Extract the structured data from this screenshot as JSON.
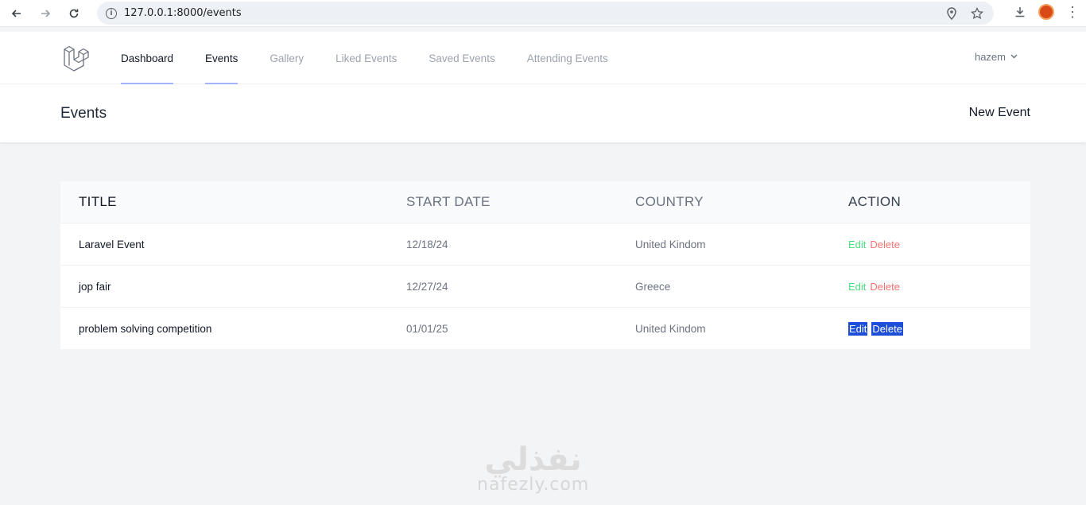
{
  "browser": {
    "url": "127.0.0.1:8000/events"
  },
  "nav": {
    "links": [
      "Dashboard",
      "Events",
      "Gallery",
      "Liked Events",
      "Saved Events",
      "Attending Events"
    ],
    "user": "hazem"
  },
  "header": {
    "title": "Events",
    "new_event": "New Event"
  },
  "table": {
    "headers": [
      "TITLE",
      "START DATE",
      "COUNTRY",
      "ACTION"
    ],
    "rows": [
      {
        "title": "Laravel Event",
        "start_date": "12/18/24",
        "country": "United Kindom",
        "edit": "Edit",
        "delete": "Delete"
      },
      {
        "title": "jop fair",
        "start_date": "12/27/24",
        "country": "Greece",
        "edit": "Edit",
        "delete": "Delete"
      },
      {
        "title": "problem solving competition",
        "start_date": "01/01/25",
        "country": "United Kindom",
        "edit": "Edit",
        "delete": "Delete"
      }
    ]
  },
  "watermark": {
    "arabic": "نفذلي",
    "latin": "nafezly.com"
  },
  "colors": {
    "edit": "#4ade80",
    "delete": "#f87171",
    "active_underline": "#a5b4fc",
    "selection": "#1d4ed8"
  }
}
